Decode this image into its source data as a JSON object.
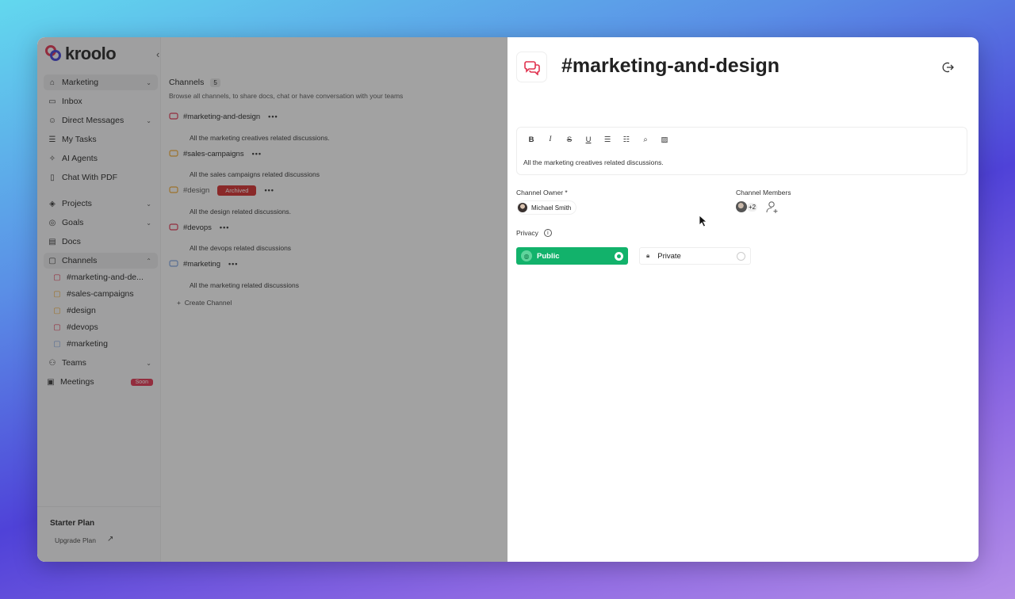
{
  "sidebar": {
    "logo_text": "kroolo",
    "items": [
      {
        "label": "Marketing",
        "icon": "home-icon"
      },
      {
        "label": "Inbox",
        "icon": "inbox-icon"
      },
      {
        "label": "Direct Messages",
        "icon": "person-icon"
      },
      {
        "label": "My Tasks",
        "icon": "checklist-icon"
      },
      {
        "label": "AI Agents",
        "icon": "sparkle-icon"
      },
      {
        "label": "Chat With PDF",
        "icon": "pdf-icon"
      },
      {
        "label": "Projects",
        "icon": "layers-icon"
      },
      {
        "label": "Goals",
        "icon": "target-icon"
      },
      {
        "label": "Docs",
        "icon": "doc-icon"
      },
      {
        "label": "Channels",
        "icon": "chat-icon"
      },
      {
        "label": "Teams",
        "icon": "team-icon"
      },
      {
        "label": "Meetings",
        "icon": "video-icon",
        "badge": "Soon"
      }
    ],
    "channels": [
      "#marketing-and-de...",
      "#sales-campaigns",
      "#design",
      "#devops",
      "#marketing"
    ],
    "plan": {
      "title": "Starter Plan",
      "link": "Upgrade Plan"
    }
  },
  "channel_list": {
    "heading": "Channels",
    "count": "5",
    "description": "Browse all channels, to share docs, chat or have conversation with your teams",
    "rows": [
      {
        "name": "#marketing-and-design",
        "note": "All the marketing creatives related discussions.",
        "color": "#e0314e"
      },
      {
        "name": "#sales-campaigns",
        "note": "All the sales campaigns related discussions",
        "color": "#f0a830"
      },
      {
        "name": "#design",
        "note": "All the design related discussions.",
        "color": "#f0a830",
        "badge": "Archived"
      },
      {
        "name": "#devops",
        "note": "All the devops related discussions",
        "color": "#e0314e"
      },
      {
        "name": "#marketing",
        "note": "All the marketing related discussions",
        "color": "#7aa0e0"
      }
    ],
    "create_label": "Create Channel"
  },
  "panel": {
    "title": "#marketing-and-design",
    "editor_text": "All the marketing creatives related discussions.",
    "toolbar": [
      "B",
      "I",
      "S",
      "U"
    ],
    "owner_label": "Channel Owner *",
    "owner_name": "Michael Smith",
    "members_label": "Channel Members",
    "members_extra": "+2",
    "privacy_label": "Privacy",
    "public_label": "Public",
    "private_label": "Private",
    "selected": "Public"
  },
  "colors": {
    "public_green": "#12b26b",
    "brand_red": "#e0314e",
    "brand_blue": "#3f3fd2"
  }
}
